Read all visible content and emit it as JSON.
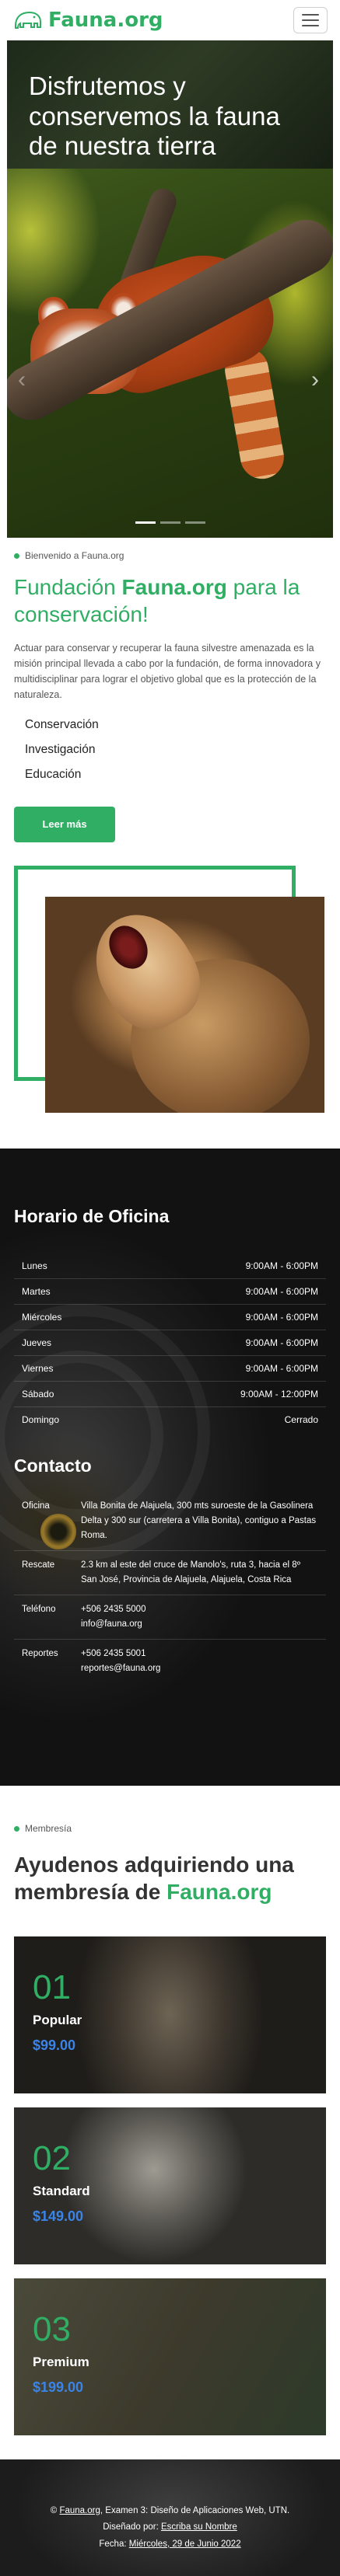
{
  "brand": {
    "name": "Fauna.org",
    "accent": "#2fae64"
  },
  "nav": {
    "menu_icon": "hamburger-icon"
  },
  "hero": {
    "title": "Disfrutemos y conservemos la fauna de nuestra tierra",
    "slides": 3,
    "active_slide": 1
  },
  "intro": {
    "eyebrow": "Bienvenido a Fauna.org",
    "title_prefix": "Fundación ",
    "title_brand": "Fauna.org",
    "title_suffix": " para la conservación!",
    "body": "Actuar para conservar y recuperar la fauna silvestre amenazada es la misión principal llevada a cabo por la fundación, de forma innovadora y multidisciplinar para lograr el objetivo global que es la protección de la naturaleza.",
    "topics": [
      "Conservación",
      "Investigación",
      "Educación"
    ],
    "cta": "Leer más"
  },
  "office": {
    "title": "Horario de Oficina",
    "rows": [
      {
        "day": "Lunes",
        "time": "9:00AM - 6:00PM"
      },
      {
        "day": "Martes",
        "time": "9:00AM - 6:00PM"
      },
      {
        "day": "Miércoles",
        "time": "9:00AM - 6:00PM"
      },
      {
        "day": "Jueves",
        "time": "9:00AM - 6:00PM"
      },
      {
        "day": "Viernes",
        "time": "9:00AM - 6:00PM"
      },
      {
        "day": "Sábado",
        "time": "9:00AM - 12:00PM"
      },
      {
        "day": "Domingo",
        "time": "Cerrado"
      }
    ]
  },
  "contact": {
    "title": "Contacto",
    "office_label": "Oficina",
    "office_value": "Villa Bonita de Alajuela, 300 mts suroeste de la Gasolinera Delta y 300 sur (carretera a Villa Bonita), contiguo a Pastas Roma.",
    "rescue_label": "Rescate",
    "rescue_value": "2.3 km al este del cruce de Manolo's, ruta 3, hacia el 8º San José, Provincia de Alajuela, Alajuela, Costa Rica",
    "phone_label": "Teléfono",
    "phone_value": "+506 2435 5000",
    "phone_email": "info@fauna.org",
    "reports_label": "Reportes",
    "reports_value": "+506 2435 5001",
    "reports_email": "reportes@fauna.org"
  },
  "membership": {
    "eyebrow": "Membresía",
    "title_prefix": "Ayudenos adquiriendo una membresía de ",
    "title_brand": "Fauna.org",
    "plans": [
      {
        "num": "01",
        "name": "Popular",
        "price": "$99.00"
      },
      {
        "num": "02",
        "name": "Standard",
        "price": "$149.00"
      },
      {
        "num": "03",
        "name": "Premium",
        "price": "$199.00"
      }
    ]
  },
  "footer": {
    "copy_prefix": "© ",
    "copy_link": "Fauna.org",
    "copy_suffix": ", Examen 3: Diseño de Aplicaciones Web, UTN.",
    "designed_prefix": "Diseñado por: ",
    "designed_link": "Escriba su Nombre",
    "date_prefix": "Fecha: ",
    "date_link": "Miércoles, 29 de Junio 2022"
  }
}
